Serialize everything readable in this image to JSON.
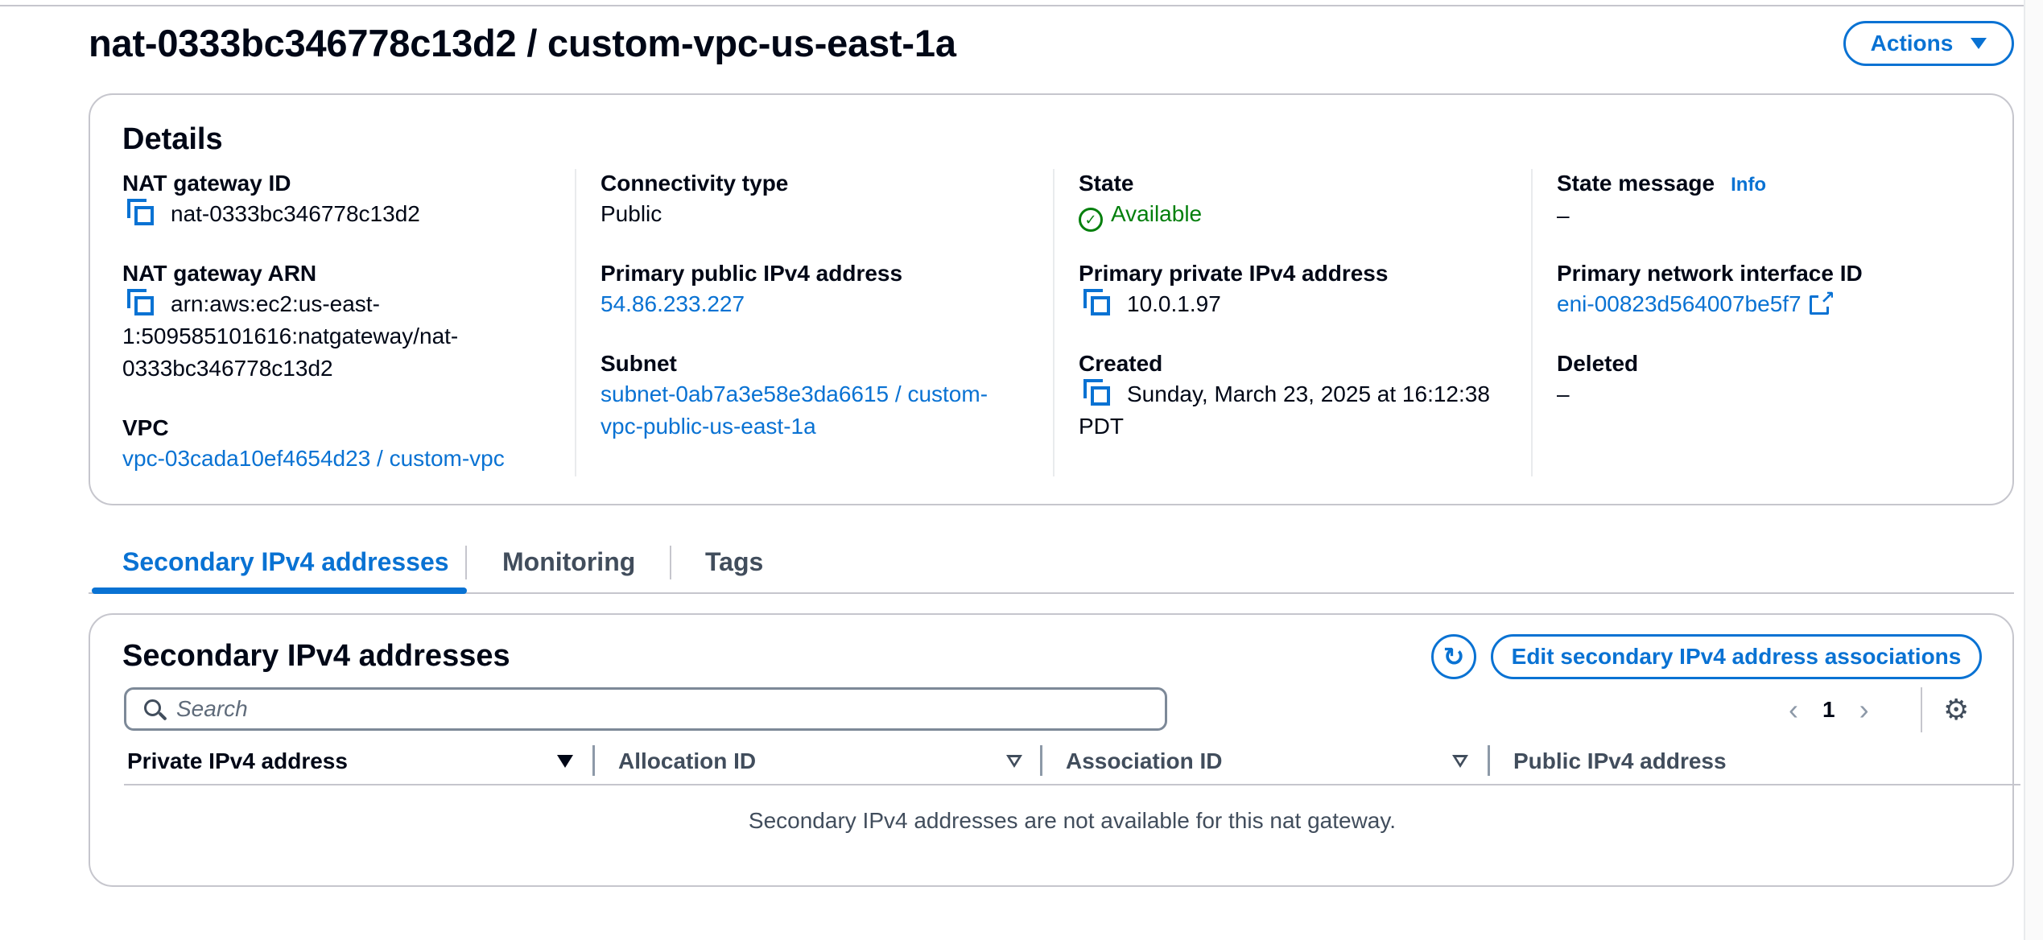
{
  "page": {
    "title": "nat-0333bc346778c13d2 / custom-vpc-us-east-1a",
    "actions_label": "Actions"
  },
  "details": {
    "heading": "Details",
    "nat_gateway_id": {
      "label": "NAT gateway ID",
      "value": "nat-0333bc346778c13d2"
    },
    "nat_gateway_arn": {
      "label": "NAT gateway ARN",
      "line1": "arn:aws:ec2:us-east-",
      "line2": "1:509585101616:natgateway/nat-",
      "line3": "0333bc346778c13d2"
    },
    "vpc": {
      "label": "VPC",
      "value": "vpc-03cada10ef4654d23 / custom-vpc"
    },
    "connectivity_type": {
      "label": "Connectivity type",
      "value": "Public"
    },
    "primary_public_ipv4": {
      "label": "Primary public IPv4 address",
      "value": "54.86.233.227"
    },
    "subnet": {
      "label": "Subnet",
      "line1": "subnet-0ab7a3e58e3da6615 / custom-",
      "line2": "vpc-public-us-east-1a"
    },
    "state": {
      "label": "State",
      "value": "Available",
      "color": "#037f0c"
    },
    "primary_private_ipv4": {
      "label": "Primary private IPv4 address",
      "value": "10.0.1.97"
    },
    "created": {
      "label": "Created",
      "line1": "Sunday, March 23, 2025 at 16:12:38",
      "line2": "PDT"
    },
    "state_message": {
      "label": "State message",
      "info": "Info",
      "value": "–"
    },
    "primary_network_interface": {
      "label": "Primary network interface ID",
      "value": "eni-00823d564007be5f7"
    },
    "deleted": {
      "label": "Deleted",
      "value": "–"
    }
  },
  "tabs": [
    {
      "label": "Secondary IPv4 addresses",
      "active": true
    },
    {
      "label": "Monitoring",
      "active": false
    },
    {
      "label": "Tags",
      "active": false
    }
  ],
  "secondary": {
    "heading": "Secondary IPv4 addresses",
    "edit_label": "Edit secondary IPv4 address associations",
    "search_placeholder": "Search",
    "page_number": "1",
    "columns": [
      "Private IPv4 address",
      "Allocation ID",
      "Association ID",
      "Public IPv4 address"
    ],
    "empty_message": "Secondary IPv4 addresses are not available for this nat gateway."
  },
  "colors": {
    "accent": "#0972d3",
    "success": "#037f0c",
    "text": "#000716",
    "border": "#c6c6cd"
  },
  "icons": [
    "copy-icon",
    "check-circle-icon",
    "external-link-icon",
    "refresh-icon",
    "search-icon",
    "chevron-left-icon",
    "chevron-right-icon",
    "settings-gear-icon",
    "sort-icon",
    "caret-down-icon"
  ]
}
